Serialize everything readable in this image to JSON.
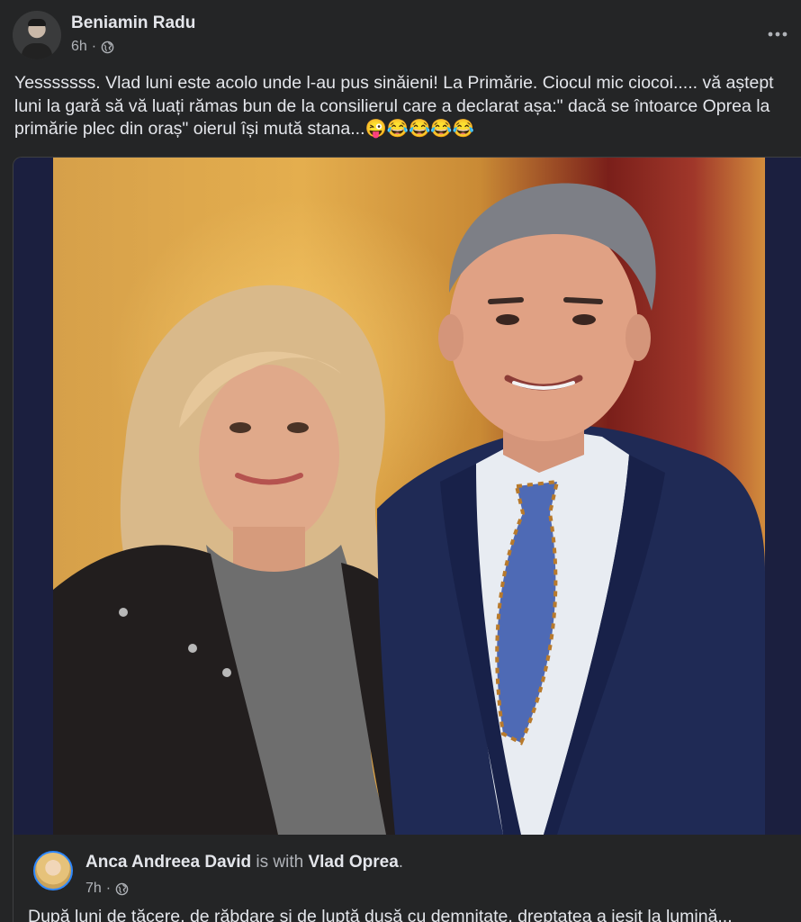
{
  "post": {
    "author": "Beniamin Radu",
    "time": "6h",
    "separator": "·",
    "privacy_icon": "globe-icon",
    "more_icon": "more-horizontal-icon",
    "text": "Yesssssss. Vlad luni este acolo unde l-au pus sinăieni! La Primărie. Ciocul mic ciocoi..... vă aștept luni la gară să vă luați rămas bun de la consilierul care a declarat așa:\" dacă se întoarce Oprea la primărie plec din oraș\" oierul își mută stana...😜😂😂😂😂"
  },
  "shared": {
    "author": "Anca Andreea David",
    "with_text": "is with",
    "tagged": "Vlad Oprea",
    "period": ".",
    "time": "7h",
    "separator": "·",
    "privacy_icon": "globe-icon",
    "text": "După luni de tăcere, de răbdare și de luptă dusă cu demnitate, dreptatea a ieșit la lumină..."
  },
  "colors": {
    "background": "#242526",
    "primary_text": "#e4e6eb",
    "secondary_text": "#b0b3b8",
    "card_border": "#3e4042",
    "photo_frame": "#1b1f3f"
  }
}
